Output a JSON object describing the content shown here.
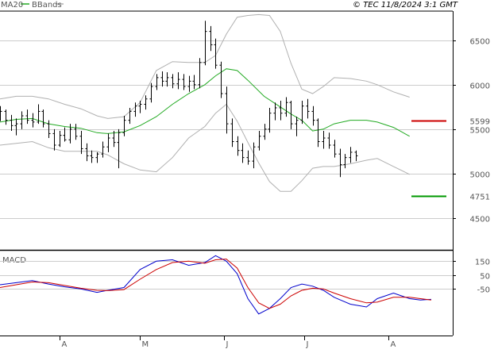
{
  "header": {
    "legend_ma": "MA20",
    "legend_bb": "BBands",
    "copyright": "© TEC 11/8/2024 3:1 GMT"
  },
  "colors": {
    "ma": "#22aa22",
    "bands": "#b0b0b0",
    "price_bars": "#000000",
    "resistance": "#cc0000",
    "support": "#009900",
    "macd": "#0000cc",
    "signal": "#cc0000",
    "grid": "#cccccc"
  },
  "chart_data": [
    {
      "type": "line",
      "description_kind": "ohlc price chart with moving average and bollinger bands",
      "y_axis": {
        "ticks": [
          "6500",
          "6000",
          "5500",
          "5000",
          "4500"
        ],
        "tick_values": [
          6500,
          6000,
          5500,
          5000,
          4500
        ],
        "ylim": [
          4150,
          6820
        ]
      },
      "x_axis": {
        "tick_labels": [
          "A",
          "M",
          "J",
          "J",
          "A"
        ],
        "tick_positions": [
          22,
          52,
          83,
          113,
          144
        ]
      },
      "x_range": [
        0,
        168
      ],
      "levels": [
        {
          "name": "resistance",
          "value": 5599,
          "label": "5599"
        },
        {
          "name": "support",
          "value": 4751,
          "label": "4751"
        }
      ],
      "series": [
        {
          "name": "MA20",
          "x": [
            0,
            6,
            12,
            18,
            24,
            30,
            36,
            40,
            46,
            52,
            58,
            64,
            70,
            76,
            80,
            84,
            88,
            92,
            98,
            104,
            108,
            112,
            116,
            120,
            124,
            130,
            136,
            140,
            146,
            152
          ],
          "values": [
            5580,
            5610,
            5620,
            5560,
            5530,
            5510,
            5460,
            5450,
            5470,
            5540,
            5640,
            5780,
            5900,
            6000,
            6100,
            6180,
            6160,
            6050,
            5870,
            5750,
            5670,
            5600,
            5480,
            5500,
            5560,
            5600,
            5600,
            5580,
            5520,
            5420
          ]
        },
        {
          "name": "BBands upper",
          "x": [
            0,
            6,
            12,
            18,
            24,
            30,
            36,
            40,
            46,
            52,
            58,
            64,
            70,
            76,
            80,
            84,
            88,
            92,
            96,
            100,
            104,
            108,
            112,
            116,
            120,
            124,
            130,
            136,
            140,
            146,
            152
          ],
          "values": [
            5840,
            5870,
            5870,
            5840,
            5780,
            5730,
            5650,
            5620,
            5640,
            5800,
            6160,
            6260,
            6250,
            6250,
            6330,
            6570,
            6760,
            6780,
            6790,
            6780,
            6600,
            6240,
            5950,
            5900,
            5980,
            6080,
            6070,
            6040,
            6000,
            5920,
            5860
          ]
        },
        {
          "name": "BBands lower",
          "x": [
            0,
            6,
            12,
            18,
            24,
            30,
            36,
            40,
            46,
            52,
            58,
            64,
            70,
            76,
            80,
            84,
            88,
            92,
            96,
            100,
            104,
            108,
            112,
            116,
            120,
            124,
            130,
            136,
            140,
            146,
            152
          ],
          "values": [
            5320,
            5340,
            5360,
            5290,
            5250,
            5250,
            5250,
            5210,
            5110,
            5040,
            5020,
            5180,
            5400,
            5530,
            5680,
            5780,
            5590,
            5350,
            5120,
            4910,
            4800,
            4800,
            4920,
            5060,
            5080,
            5080,
            5110,
            5150,
            5170,
            5080,
            4990
          ]
        }
      ],
      "ohlc": [
        {
          "x": 0,
          "o": 5680,
          "h": 5760,
          "l": 5590,
          "c": 5700
        },
        {
          "x": 2,
          "o": 5700,
          "h": 5720,
          "l": 5550,
          "c": 5600
        },
        {
          "x": 4,
          "o": 5600,
          "h": 5660,
          "l": 5480,
          "c": 5540
        },
        {
          "x": 6,
          "o": 5540,
          "h": 5620,
          "l": 5430,
          "c": 5560
        },
        {
          "x": 8,
          "o": 5560,
          "h": 5700,
          "l": 5500,
          "c": 5650
        },
        {
          "x": 10,
          "o": 5650,
          "h": 5720,
          "l": 5560,
          "c": 5600
        },
        {
          "x": 12,
          "o": 5600,
          "h": 5680,
          "l": 5520,
          "c": 5580
        },
        {
          "x": 14,
          "o": 5580,
          "h": 5780,
          "l": 5560,
          "c": 5700
        },
        {
          "x": 16,
          "o": 5700,
          "h": 5720,
          "l": 5520,
          "c": 5560
        },
        {
          "x": 18,
          "o": 5560,
          "h": 5600,
          "l": 5400,
          "c": 5450
        },
        {
          "x": 20,
          "o": 5450,
          "h": 5500,
          "l": 5260,
          "c": 5320
        },
        {
          "x": 22,
          "o": 5320,
          "h": 5480,
          "l": 5300,
          "c": 5430
        },
        {
          "x": 24,
          "o": 5430,
          "h": 5520,
          "l": 5360,
          "c": 5380
        },
        {
          "x": 26,
          "o": 5380,
          "h": 5560,
          "l": 5340,
          "c": 5500
        },
        {
          "x": 28,
          "o": 5500,
          "h": 5560,
          "l": 5380,
          "c": 5420
        },
        {
          "x": 30,
          "o": 5420,
          "h": 5480,
          "l": 5220,
          "c": 5280
        },
        {
          "x": 32,
          "o": 5280,
          "h": 5340,
          "l": 5140,
          "c": 5200
        },
        {
          "x": 34,
          "o": 5200,
          "h": 5260,
          "l": 5120,
          "c": 5180
        },
        {
          "x": 36,
          "o": 5180,
          "h": 5240,
          "l": 5120,
          "c": 5220
        },
        {
          "x": 38,
          "o": 5220,
          "h": 5360,
          "l": 5180,
          "c": 5300
        },
        {
          "x": 40,
          "o": 5300,
          "h": 5450,
          "l": 5240,
          "c": 5400
        },
        {
          "x": 42,
          "o": 5400,
          "h": 5480,
          "l": 5300,
          "c": 5350
        },
        {
          "x": 44,
          "o": 5350,
          "h": 5500,
          "l": 5060,
          "c": 5460
        },
        {
          "x": 46,
          "o": 5460,
          "h": 5650,
          "l": 5420,
          "c": 5600
        },
        {
          "x": 48,
          "o": 5600,
          "h": 5740,
          "l": 5560,
          "c": 5700
        },
        {
          "x": 50,
          "o": 5700,
          "h": 5800,
          "l": 5640,
          "c": 5760
        },
        {
          "x": 52,
          "o": 5760,
          "h": 5820,
          "l": 5680,
          "c": 5780
        },
        {
          "x": 54,
          "o": 5780,
          "h": 5880,
          "l": 5720,
          "c": 5840
        },
        {
          "x": 56,
          "o": 5840,
          "h": 6020,
          "l": 5800,
          "c": 5980
        },
        {
          "x": 58,
          "o": 5980,
          "h": 6120,
          "l": 5940,
          "c": 6080
        },
        {
          "x": 60,
          "o": 6080,
          "h": 6150,
          "l": 5980,
          "c": 6040
        },
        {
          "x": 62,
          "o": 6040,
          "h": 6140,
          "l": 5980,
          "c": 6080
        },
        {
          "x": 64,
          "o": 6080,
          "h": 6120,
          "l": 5960,
          "c": 6010
        },
        {
          "x": 66,
          "o": 6010,
          "h": 6140,
          "l": 5950,
          "c": 6060
        },
        {
          "x": 68,
          "o": 6060,
          "h": 6120,
          "l": 5940,
          "c": 5980
        },
        {
          "x": 70,
          "o": 5980,
          "h": 6100,
          "l": 5920,
          "c": 6040
        },
        {
          "x": 72,
          "o": 6040,
          "h": 6110,
          "l": 5950,
          "c": 6000
        },
        {
          "x": 74,
          "o": 6000,
          "h": 6300,
          "l": 5960,
          "c": 6250
        },
        {
          "x": 76,
          "o": 6250,
          "h": 6720,
          "l": 6220,
          "c": 6600
        },
        {
          "x": 78,
          "o": 6600,
          "h": 6660,
          "l": 6380,
          "c": 6450
        },
        {
          "x": 80,
          "o": 6450,
          "h": 6520,
          "l": 6180,
          "c": 6220
        },
        {
          "x": 82,
          "o": 6220,
          "h": 6260,
          "l": 5850,
          "c": 5900
        },
        {
          "x": 84,
          "o": 5900,
          "h": 5980,
          "l": 5450,
          "c": 5560
        },
        {
          "x": 86,
          "o": 5560,
          "h": 5620,
          "l": 5300,
          "c": 5360
        },
        {
          "x": 88,
          "o": 5360,
          "h": 5420,
          "l": 5200,
          "c": 5260
        },
        {
          "x": 90,
          "o": 5260,
          "h": 5340,
          "l": 5120,
          "c": 5180
        },
        {
          "x": 92,
          "o": 5180,
          "h": 5260,
          "l": 5100,
          "c": 5140
        },
        {
          "x": 94,
          "o": 5140,
          "h": 5350,
          "l": 5060,
          "c": 5300
        },
        {
          "x": 96,
          "o": 5300,
          "h": 5480,
          "l": 5260,
          "c": 5420
        },
        {
          "x": 98,
          "o": 5420,
          "h": 5560,
          "l": 5380,
          "c": 5500
        },
        {
          "x": 100,
          "o": 5500,
          "h": 5740,
          "l": 5460,
          "c": 5680
        },
        {
          "x": 102,
          "o": 5680,
          "h": 5800,
          "l": 5600,
          "c": 5740
        },
        {
          "x": 104,
          "o": 5740,
          "h": 5820,
          "l": 5600,
          "c": 5680
        },
        {
          "x": 106,
          "o": 5680,
          "h": 5860,
          "l": 5640,
          "c": 5800
        },
        {
          "x": 108,
          "o": 5800,
          "h": 5820,
          "l": 5500,
          "c": 5560
        },
        {
          "x": 110,
          "o": 5560,
          "h": 5640,
          "l": 5420,
          "c": 5600
        },
        {
          "x": 112,
          "o": 5600,
          "h": 5820,
          "l": 5560,
          "c": 5760
        },
        {
          "x": 114,
          "o": 5760,
          "h": 5840,
          "l": 5620,
          "c": 5700
        },
        {
          "x": 116,
          "o": 5700,
          "h": 5760,
          "l": 5540,
          "c": 5600
        },
        {
          "x": 118,
          "o": 5600,
          "h": 5620,
          "l": 5300,
          "c": 5360
        },
        {
          "x": 120,
          "o": 5360,
          "h": 5480,
          "l": 5280,
          "c": 5400
        },
        {
          "x": 122,
          "o": 5400,
          "h": 5460,
          "l": 5280,
          "c": 5320
        },
        {
          "x": 124,
          "o": 5320,
          "h": 5380,
          "l": 5180,
          "c": 5220
        },
        {
          "x": 126,
          "o": 5220,
          "h": 5280,
          "l": 4960,
          "c": 5100
        },
        {
          "x": 128,
          "o": 5100,
          "h": 5220,
          "l": 5060,
          "c": 5180
        },
        {
          "x": 130,
          "o": 5180,
          "h": 5300,
          "l": 5120,
          "c": 5240
        },
        {
          "x": 132,
          "o": 5240,
          "h": 5260,
          "l": 5140,
          "c": 5200
        }
      ]
    },
    {
      "type": "line",
      "title": "MACD",
      "y_axis": {
        "ticks": [
          "150",
          "50",
          "-50"
        ],
        "tick_values": [
          150,
          50,
          -50
        ],
        "ylim": [
          -380,
          220
        ]
      },
      "x_range": [
        0,
        168
      ],
      "series": [
        {
          "name": "MACD",
          "x": [
            0,
            6,
            12,
            18,
            24,
            30,
            36,
            40,
            46,
            52,
            58,
            64,
            70,
            76,
            80,
            84,
            88,
            92,
            96,
            100,
            104,
            108,
            112,
            116,
            120,
            124,
            130,
            136,
            140,
            146,
            152,
            156,
            160
          ],
          "values": [
            -20,
            -5,
            10,
            -15,
            -35,
            -50,
            -75,
            -60,
            -40,
            90,
            150,
            160,
            120,
            140,
            190,
            150,
            60,
            -120,
            -230,
            -190,
            -120,
            -40,
            -15,
            -30,
            -60,
            -110,
            -160,
            -180,
            -120,
            -80,
            -120,
            -130,
            -125
          ]
        },
        {
          "name": "Signal",
          "x": [
            0,
            6,
            12,
            18,
            24,
            30,
            36,
            40,
            46,
            52,
            58,
            64,
            70,
            76,
            80,
            84,
            88,
            92,
            96,
            100,
            104,
            108,
            112,
            116,
            120,
            124,
            130,
            136,
            140,
            146,
            152,
            156,
            160
          ],
          "values": [
            -40,
            -20,
            0,
            -5,
            -25,
            -45,
            -60,
            -62,
            -55,
            20,
            90,
            140,
            150,
            135,
            160,
            165,
            100,
            -40,
            -150,
            -190,
            -160,
            -100,
            -60,
            -45,
            -50,
            -80,
            -120,
            -150,
            -145,
            -110,
            -110,
            -120,
            -130
          ]
        }
      ]
    }
  ]
}
